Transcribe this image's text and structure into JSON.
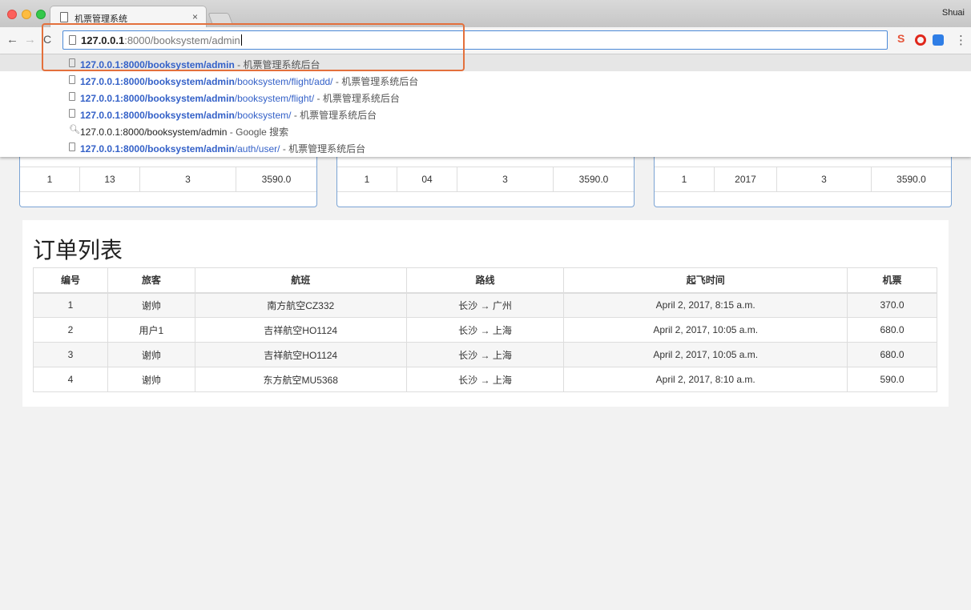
{
  "browser": {
    "tab_title": "机票管理系统",
    "tab_close": "×",
    "profile_name": "Shuai",
    "address": {
      "host": "127.0.0.1",
      "rest": ":8000/booksystem/admin"
    }
  },
  "suggestions": [
    {
      "bold": "127.0.0.1:8000/booksystem/admin",
      "rest": "",
      "sep": " - ",
      "desc": "机票管理系统后台",
      "type": "page"
    },
    {
      "bold": "127.0.0.1:8000/booksystem/admin",
      "rest": "/booksystem/flight/add/",
      "sep": " - ",
      "desc": "机票管理系统后台",
      "type": "page"
    },
    {
      "bold": "127.0.0.1:8000/booksystem/admin",
      "rest": "/booksystem/flight/",
      "sep": " - ",
      "desc": "机票管理系统后台",
      "type": "page"
    },
    {
      "bold": "127.0.0.1:8000/booksystem/admin",
      "rest": "/booksystem/",
      "sep": " - ",
      "desc": "机票管理系统后台",
      "type": "page"
    },
    {
      "bold": "127.0.0.1:8000/booksystem/admin",
      "rest": "",
      "sep": " - ",
      "desc": "Google 搜索",
      "type": "search"
    },
    {
      "bold": "127.0.0.1:8000/booksystem/admin",
      "rest": "/auth/user/",
      "sep": " - ",
      "desc": "机票管理系统后台",
      "type": "page"
    }
  ],
  "stat_cards": [
    {
      "cells": [
        "1",
        "13",
        "3",
        "3590.0"
      ]
    },
    {
      "cells": [
        "1",
        "04",
        "3",
        "3590.0"
      ]
    },
    {
      "cells": [
        "1",
        "2017",
        "3",
        "3590.0"
      ]
    }
  ],
  "orders": {
    "title": "订单列表",
    "headers": [
      "编号",
      "旅客",
      "航班",
      "路线",
      "起飞时间",
      "机票"
    ],
    "rows": [
      [
        "1",
        "谢帅",
        "南方航空CZ332",
        "长沙 → 广州",
        "April 2, 2017, 8:15 a.m.",
        "370.0"
      ],
      [
        "2",
        "用户1",
        "吉祥航空HO1124",
        "长沙 → 上海",
        "April 2, 2017, 10:05 a.m.",
        "680.0"
      ],
      [
        "3",
        "谢帅",
        "吉祥航空HO1124",
        "长沙 → 上海",
        "April 2, 2017, 10:05 a.m.",
        "680.0"
      ],
      [
        "4",
        "谢帅",
        "东方航空MU5368",
        "长沙 → 上海",
        "April 2, 2017, 8:10 a.m.",
        "590.0"
      ]
    ]
  },
  "colors": {
    "accent_highlight": "#e3703c",
    "link_blue": "#3461c8"
  }
}
